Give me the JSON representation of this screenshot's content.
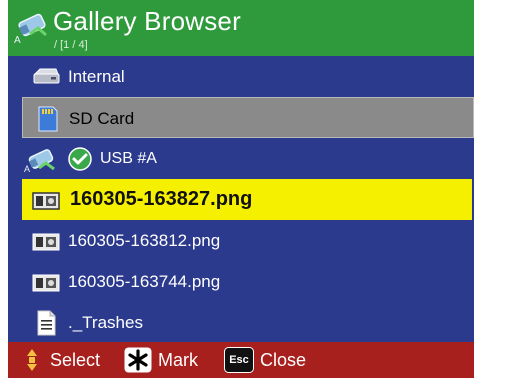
{
  "titlebar": {
    "title": "Gallery Browser",
    "path": "/     [1 / 4]",
    "icon": "usb-drive-icon",
    "icon_letter": "A"
  },
  "list": {
    "items": [
      {
        "label": "Internal",
        "icon": "internal-drive-icon",
        "state": "normal"
      },
      {
        "label": "SD Card",
        "icon": "sd-card-icon",
        "state": "highlight"
      },
      {
        "label": "USB #A",
        "icon": "usb-drive-icon",
        "state": "normal",
        "status_icon": "check-icon",
        "icon_letter": "A"
      },
      {
        "label": "160305-163827.png",
        "icon": "image-file-icon",
        "state": "selected"
      },
      {
        "label": "160305-163812.png",
        "icon": "image-file-icon",
        "state": "normal"
      },
      {
        "label": "160305-163744.png",
        "icon": "image-file-icon",
        "state": "normal"
      },
      {
        "label": "._Trashes",
        "icon": "document-icon",
        "state": "normal"
      }
    ]
  },
  "footer": {
    "select_label": "Select",
    "mark_label": "Mark",
    "close_label": "Close",
    "esc_key": "Esc"
  },
  "colors": {
    "background": "#2b3a8c",
    "titlebar": "#2f9a3c",
    "footer": "#a8201e",
    "selected": "#f5f000",
    "highlight": "#8a8a8a"
  }
}
